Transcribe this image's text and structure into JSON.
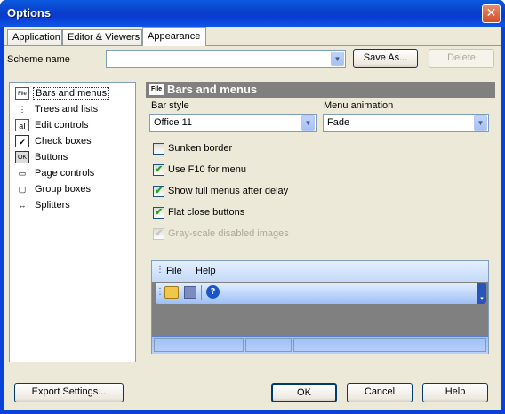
{
  "window": {
    "title": "Options",
    "close_glyph": "✕"
  },
  "tabs": [
    {
      "label": "Application"
    },
    {
      "label": "Editor & Viewers"
    },
    {
      "label": "Appearance"
    }
  ],
  "scheme": {
    "label": "Scheme name",
    "value": "",
    "save_as": "Save As...",
    "delete": "Delete"
  },
  "tree": {
    "items": [
      {
        "label": "Bars and menus",
        "icon": "bars-menus-icon",
        "glyph": "File"
      },
      {
        "label": "Trees and lists",
        "icon": "tree-icon",
        "glyph": "⋮"
      },
      {
        "label": "Edit controls",
        "icon": "edit-control-icon",
        "glyph": "aI"
      },
      {
        "label": "Check boxes",
        "icon": "checkbox-icon",
        "glyph": "✔"
      },
      {
        "label": "Buttons",
        "icon": "button-icon",
        "glyph": "OK"
      },
      {
        "label": "Page controls",
        "icon": "page-control-icon",
        "glyph": "▭"
      },
      {
        "label": "Group boxes",
        "icon": "group-box-icon",
        "glyph": "▢"
      },
      {
        "label": "Splitters",
        "icon": "splitter-icon",
        "glyph": "↔"
      }
    ]
  },
  "section": {
    "title": "Bars and menus",
    "icon_glyph": "File",
    "bar_style_label": "Bar style",
    "bar_style_value": "Office 11",
    "menu_animation_label": "Menu animation",
    "menu_animation_value": "Fade"
  },
  "options": [
    {
      "label": "Sunken border",
      "checked": false,
      "disabled": false
    },
    {
      "label": "Use F10 for menu",
      "checked": true,
      "disabled": false
    },
    {
      "label": "Show full menus after delay",
      "checked": true,
      "disabled": false
    },
    {
      "label": "Flat close buttons",
      "checked": true,
      "disabled": false
    },
    {
      "label": "Gray-scale disabled images",
      "checked": true,
      "disabled": true
    }
  ],
  "preview": {
    "menu_file": "File",
    "menu_help": "Help"
  },
  "footer": {
    "export": "Export Settings...",
    "ok": "OK",
    "cancel": "Cancel",
    "help": "Help"
  },
  "colors": {
    "titlebar": "#0a3fc8",
    "dialog_bg": "#ece9d8",
    "section_header": "#808080",
    "active_tab_accent": "#e68b2c"
  }
}
